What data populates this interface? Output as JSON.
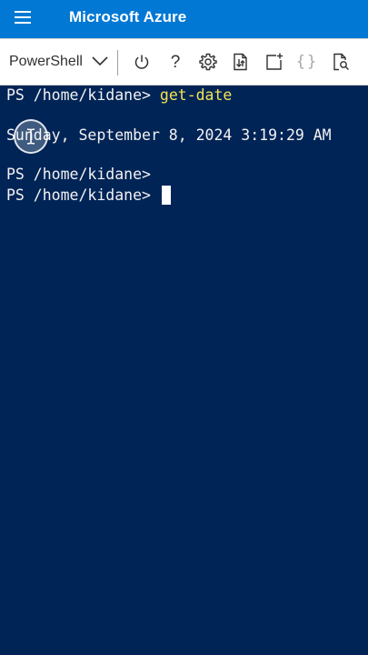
{
  "header": {
    "title": "Microsoft Azure",
    "menu_icon": "hamburger-menu-icon"
  },
  "toolbar": {
    "shell_selected": "PowerShell",
    "help_glyph": "?",
    "braces_glyph": "{}",
    "icons": [
      "chevron-down-icon",
      "power-icon",
      "help-icon",
      "settings-gear-icon",
      "upload-download-icon",
      "new-session-icon",
      "editor-braces-icon",
      "web-preview-icon"
    ]
  },
  "terminal": {
    "line1_prompt": "PS /home/kidane> ",
    "line1_command": "get-date",
    "line2_output": "Sunday, September 8, 2024 3:19:29 AM",
    "line3_prompt": "PS /home/kidane>",
    "line4_prompt": "PS /home/kidane> "
  },
  "colors": {
    "header_bg": "#0078d4",
    "terminal_bg": "#012456",
    "command_text": "#f4e455",
    "terminal_text": "#f2f2f2"
  }
}
